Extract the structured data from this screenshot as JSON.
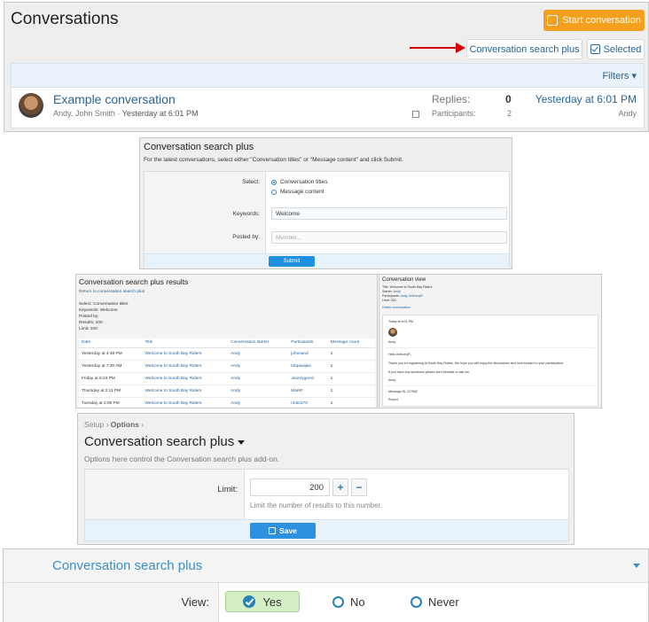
{
  "p1": {
    "title": "Conversations",
    "start_btn": "Start conversation",
    "csp_btn": "Conversation search plus",
    "selected_btn": "Selected",
    "filters": "Filters",
    "conv_title": "Example conversation",
    "conv_participants": "Andy, John Smith",
    "conv_sep": " · ",
    "conv_date": "Yesterday at 6:01 PM",
    "replies_label": "Replies:",
    "replies_value": "0",
    "participants_label": "Participants:",
    "participants_value": "2",
    "last_date": "Yesterday at 6:01 PM",
    "last_user": "Andy"
  },
  "p2": {
    "title": "Conversation search plus",
    "desc": "For the latest conversations, select either \"Conversation titles\" or \"Message content\" and click Submit.",
    "select_label": "Select:",
    "opt1": "Conversation titles",
    "opt2": "Message content",
    "keywords_label": "Keywords:",
    "keywords_value": "Welcome",
    "posted_label": "Posted by:",
    "posted_placeholder": "Member...",
    "submit": "Submit"
  },
  "p3": {
    "title": "Conversation search plus results",
    "back": "Return to conversation search plus",
    "meta": [
      "Select: Conversation titles",
      "Keywords: Welcome",
      "Posted by:",
      "Results: 200",
      "Limit: 200"
    ],
    "columns": [
      "Date",
      "Title",
      "Conversation starter",
      "Participants",
      "Message count"
    ],
    "rows": [
      [
        "Yesterday at 4:48 PM",
        "Welcome to South Bay Riders",
        "Andy",
        "johnsand",
        "1"
      ],
      [
        "Yesterday at 7:20 AM",
        "Welcome to South Bay Riders",
        "Andy",
        "tobpawjaw",
        "1"
      ],
      [
        "Friday at 6:24 PM",
        "Welcome to South Bay Riders",
        "Andy",
        "Jeanrygemz",
        "1"
      ],
      [
        "Thursday at 2:11 PM",
        "Welcome to South Bay Riders",
        "Andy",
        "MarkF",
        "1"
      ],
      [
        "Tuesday at 2:05 PM",
        "Welcome to South Bay Riders",
        "Andy",
        "moto170",
        "1"
      ]
    ]
  },
  "p4": {
    "title": "Conversation view",
    "meta_title": "Title: Welcome to South Bay Riders",
    "meta_starter_l": "Starter: ",
    "meta_starter_v": "Andy",
    "meta_parts_l": "Participants: ",
    "meta_parts_v": "andy, AnthonyR",
    "meta_limit": "Limit: 200",
    "delete": "Delete conversation",
    "msg_date": "Today at 6:01 PM",
    "msg_user": "Andy",
    "msg_hello": "Hello AnthonyR,",
    "msg_body": "Thank you for registering at South Bay Riders. We hope you will enjoy the discussions and look forward to your participation.",
    "msg_q": "If you have any questions please don't hesitate to ask me.",
    "msg_sign": "Andy",
    "msg_id": "Message ID: 227962",
    "report": "Report"
  },
  "p5": {
    "crumb1": "Setup",
    "crumb2": "Options",
    "crumb_sep": " › ",
    "title": "Conversation search plus",
    "desc": "Options here control the Conversation search plus add-on.",
    "limit_label": "Limit:",
    "limit_value": "200",
    "plus": "+",
    "minus": "−",
    "hint": "Limit the number of results to this number.",
    "save": "Save"
  },
  "p6": {
    "title": "Conversation search plus",
    "view_label": "View:",
    "yes": "Yes",
    "no": "No",
    "never": "Never"
  },
  "colors": {
    "accent_orange": "#f5a01d",
    "link_blue": "#2a6496",
    "arrow_red": "#d40000",
    "button_blue": "#1f8fe0",
    "yes_green": "#d4efc6"
  }
}
